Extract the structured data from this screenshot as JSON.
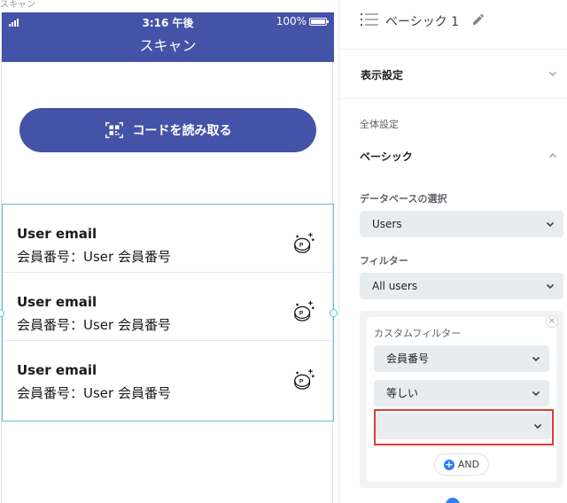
{
  "canvas": {
    "frame_label": "スキャン"
  },
  "phone": {
    "status": {
      "time": "3:16 午後",
      "battery": "100%"
    },
    "app_bar_title": "スキャン",
    "scan_button": {
      "label": "コードを読み取る",
      "icon": "qr-scan-icon"
    },
    "list_items": [
      {
        "title": "User email",
        "subtitle": "会員番号：User 会員番号",
        "icon": "coin-points-icon"
      },
      {
        "title": "User email",
        "subtitle": "会員番号：User 会員番号",
        "icon": "coin-points-icon"
      },
      {
        "title": "User email",
        "subtitle": "会員番号：User 会員番号",
        "icon": "coin-points-icon"
      }
    ]
  },
  "panel": {
    "title": "ベーシック 1",
    "display_settings": "表示設定",
    "overall_settings": "全体設定",
    "basic": "ベーシック",
    "database_label": "データベースの選択",
    "database_value": "Users",
    "filter_label": "フィルター",
    "filter_value": "All users",
    "custom_filter": {
      "label": "カスタムフィルター",
      "field": "会員番号",
      "operator": "等しい",
      "value": ""
    },
    "and_button": "AND"
  },
  "colors": {
    "primary": "#4452a8",
    "selection": "#5ec4bf",
    "highlight": "#e53935",
    "accent": "#2d7ff9"
  }
}
